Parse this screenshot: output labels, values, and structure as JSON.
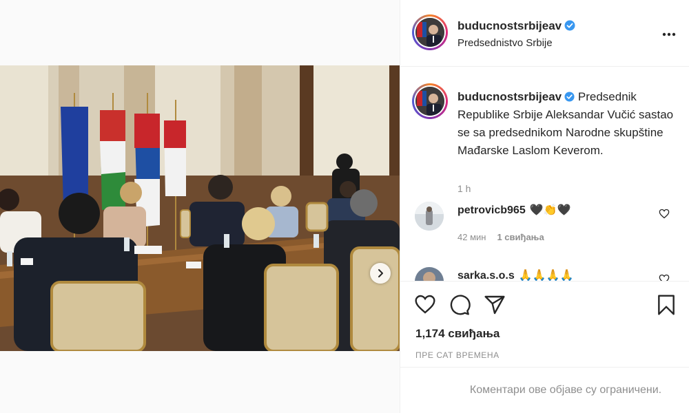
{
  "post": {
    "username": "buducnostsrbijeav",
    "verified": true,
    "location": "Predsednistvo Srbije",
    "media": {
      "carousel_count": 3,
      "active_index": 0,
      "next_icon": "chevron-right-icon"
    },
    "caption": {
      "username": "buducnostsrbijeav",
      "text": "Predsednik Republike Srbije Aleksandar Vučić sastao se sa predsednikom Narodne skupštine Mađarske Laslom Keverom.",
      "time": "1 h"
    },
    "comments": [
      {
        "username": "petrovicb965",
        "text": "🖤👏🖤",
        "time": "42 мин",
        "likes": "1 свиђања"
      },
      {
        "username": "sarka.s.o.s",
        "text": "🙏🙏🙏🙏",
        "time": "",
        "likes": ""
      }
    ],
    "actions": {
      "like_icon": "heart-icon",
      "comment_icon": "comment-icon",
      "share_icon": "share-icon",
      "save_icon": "bookmark-icon"
    },
    "likes_count": "1,174 свиђања",
    "time_ago": "ПРЕ САТ ВРЕМЕНА",
    "comments_disabled": "Коментари ове објаве су ограничени."
  },
  "colors": {
    "text": "#262626",
    "muted": "#8e8e8e",
    "border": "#efefef",
    "verified": "#3897f0",
    "dot_active": "#3897f0"
  }
}
